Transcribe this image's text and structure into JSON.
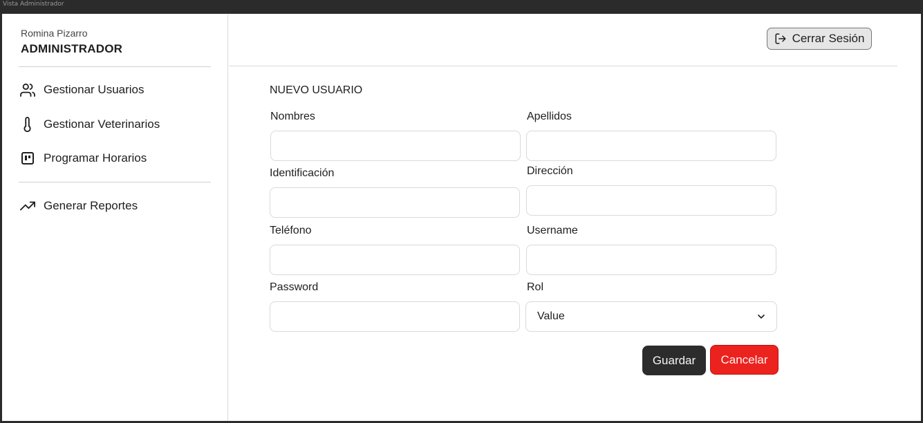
{
  "window": {
    "title": "Vista Administrador"
  },
  "sidebar": {
    "user_name": "Romina Pizarro",
    "user_role": "ADMINISTRADOR",
    "items": [
      {
        "label": "Gestionar Usuarios",
        "icon": "users-icon"
      },
      {
        "label": "Gestionar Veterinarios",
        "icon": "thermometer-icon"
      },
      {
        "label": "Programar Horarios",
        "icon": "kanban-icon"
      },
      {
        "label": "Generar Reportes",
        "icon": "trending-up-icon"
      }
    ]
  },
  "header": {
    "logout_label": "Cerrar Sesión",
    "logout_icon": "log-out-icon"
  },
  "form": {
    "title": "NUEVO USUARIO",
    "fields": {
      "nombres": {
        "label": "Nombres",
        "value": ""
      },
      "apellidos": {
        "label": "Apellidos",
        "value": ""
      },
      "identificacion": {
        "label": "Identificación",
        "value": ""
      },
      "direccion": {
        "label": "Dirección",
        "value": ""
      },
      "telefono": {
        "label": "Teléfono",
        "value": ""
      },
      "username": {
        "label": "Username",
        "value": ""
      },
      "password": {
        "label": "Password",
        "value": ""
      },
      "rol": {
        "label": "Rol",
        "value": "Value"
      }
    },
    "save_label": "Guardar",
    "cancel_label": "Cancelar"
  },
  "colors": {
    "primary_button": "#2c2c2c",
    "danger_button": "#ec221f",
    "border": "#d9d9d9"
  }
}
